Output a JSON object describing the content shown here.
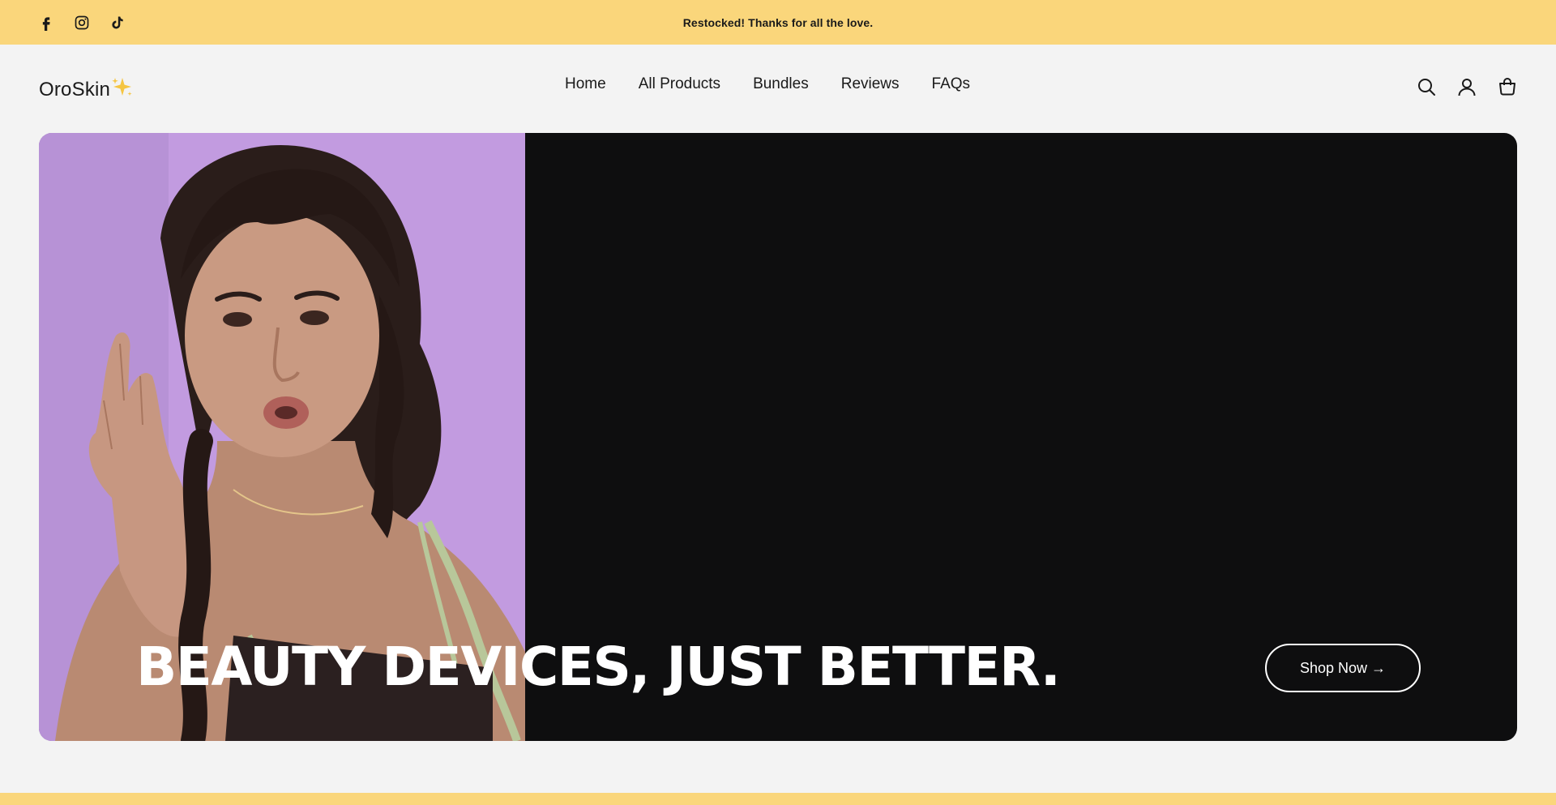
{
  "announcement": {
    "message": "Restocked! Thanks for all the love.",
    "social_icons": [
      "facebook-icon",
      "instagram-icon",
      "tiktok-icon"
    ],
    "background": "#fad67b"
  },
  "header": {
    "logo_text": "OroSkin",
    "logo_sparkle": "✨",
    "nav": [
      {
        "label": "Home"
      },
      {
        "label": "All Products"
      },
      {
        "label": "Bundles"
      },
      {
        "label": "Reviews"
      },
      {
        "label": "FAQs"
      }
    ],
    "icons": [
      "search-icon",
      "account-icon",
      "cart-icon"
    ]
  },
  "hero": {
    "title": "BEAUTY DEVICES, JUST BETTER.",
    "cta_label": "Shop Now →",
    "background": "#0e0e0f",
    "photo_background": "#c39bdf"
  },
  "colors": {
    "page_background": "#f3f3f3",
    "accent": "#fad67b",
    "text": "#1a1a1a"
  }
}
